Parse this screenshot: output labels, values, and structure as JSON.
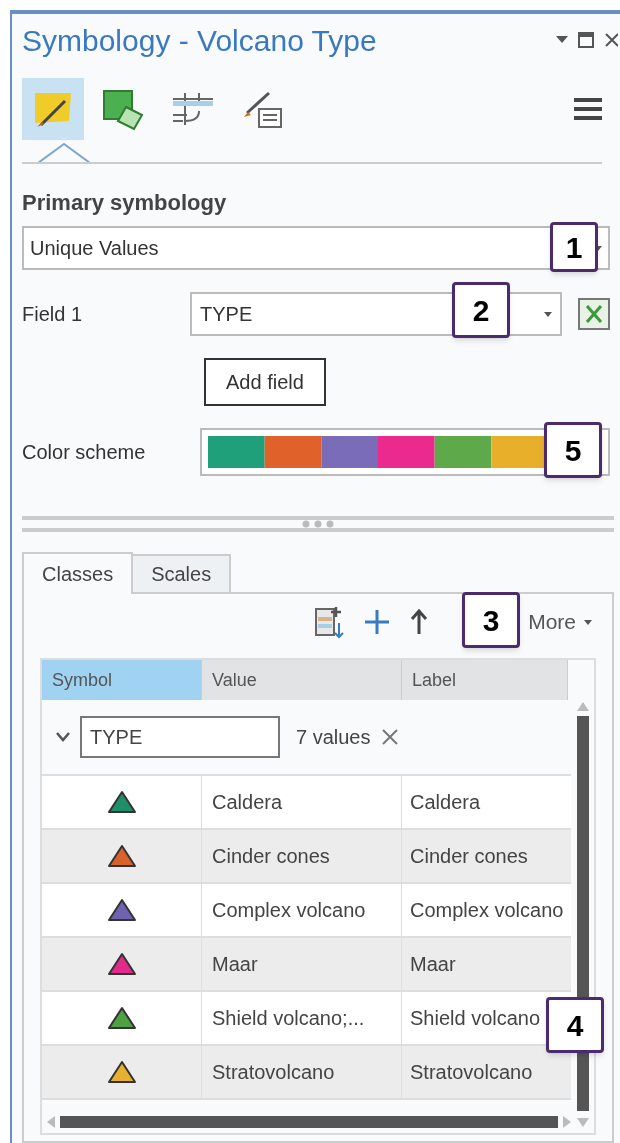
{
  "window": {
    "title": "Symbology - Volcano Type"
  },
  "tool_tabs": [
    {
      "selected": true
    },
    {
      "selected": false
    },
    {
      "selected": false
    },
    {
      "selected": false
    }
  ],
  "primary_symbology": {
    "label": "Primary symbology",
    "value": "Unique Values",
    "callout": "1"
  },
  "field_1": {
    "label": "Field 1",
    "value": "TYPE",
    "callout": "2"
  },
  "add_field_button": "Add field",
  "color_scheme": {
    "label": "Color scheme",
    "swatches": [
      {
        "color": "#1fa07a"
      },
      {
        "color": "#e0622a"
      },
      {
        "color": "#7a6cb8"
      },
      {
        "color": "#ea2a8c"
      },
      {
        "color": "#5ea94a"
      },
      {
        "color": "#e8b02a"
      }
    ],
    "callout": "5"
  },
  "tabs": [
    {
      "label": "Classes",
      "selected": true
    },
    {
      "label": "Scales",
      "selected": false
    }
  ],
  "toolbar": {
    "more": "More",
    "callout": "3"
  },
  "table": {
    "columns": [
      {
        "label": "Symbol",
        "selected": true
      },
      {
        "label": "Value",
        "selected": false
      },
      {
        "label": "Label",
        "selected": false
      }
    ],
    "group": {
      "field": "TYPE",
      "count": "7 values"
    },
    "rows": [
      {
        "color": "#1f8f6a",
        "value": "Caldera",
        "label": "Caldera"
      },
      {
        "color": "#d9622a",
        "value": "Cinder cones",
        "label": "Cinder cones"
      },
      {
        "color": "#6f63b0",
        "value": "Complex volcano",
        "label": "Complex volcano"
      },
      {
        "color": "#e22a8a",
        "value": "Maar",
        "label": "Maar"
      },
      {
        "color": "#4fa043",
        "value": "Shield volcano;...",
        "label": "Shield volcano"
      },
      {
        "color": "#e8b030",
        "value": "Stratovolcano",
        "label": "Stratovolcano"
      }
    ],
    "callout": "4"
  }
}
